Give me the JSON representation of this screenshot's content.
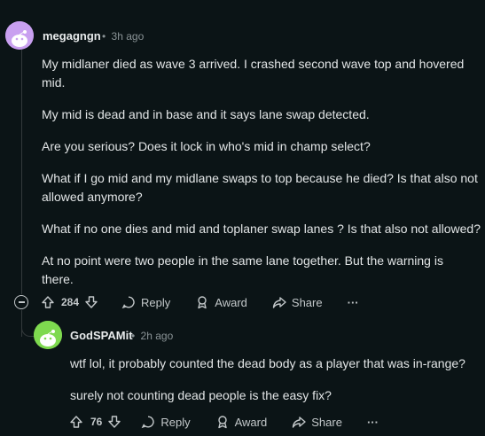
{
  "comment1": {
    "username": "megagngn",
    "time": "3h ago",
    "dot": "•",
    "paragraphs": [
      "My midlaner died as wave 3 arrived. I crashed second wave top and hovered mid.",
      "My mid is dead and in base and it says lane swap detected.",
      "Are you serious? Does it lock in who's mid in champ select?",
      "What if I go mid and my midlane swaps to top because he died? Is that also not allowed anymore?",
      "What if no one dies and mid and toplaner swap lanes ? Is that also not allowed?",
      "At no point were two people in the same lane together. But the warning is there."
    ],
    "votes": "284",
    "reply_label": "Reply",
    "award_label": "Award",
    "share_label": "Share",
    "more_label": "···",
    "avatar_color": "#c9a0f0"
  },
  "comment2": {
    "username": "GodSPAMit",
    "time": "2h ago",
    "dot": "•",
    "paragraphs": [
      "wtf lol, it probably counted the dead body as a player that was in-range?",
      "surely not counting dead people is the easy fix?"
    ],
    "votes": "76",
    "reply_label": "Reply",
    "award_label": "Award",
    "share_label": "Share",
    "more_label": "···",
    "avatar_color": "#7ed94f"
  },
  "colors": {
    "background": "#0b1416",
    "thread_line": "#33393b",
    "text": "#e2e5e6",
    "muted": "#8a9396"
  }
}
